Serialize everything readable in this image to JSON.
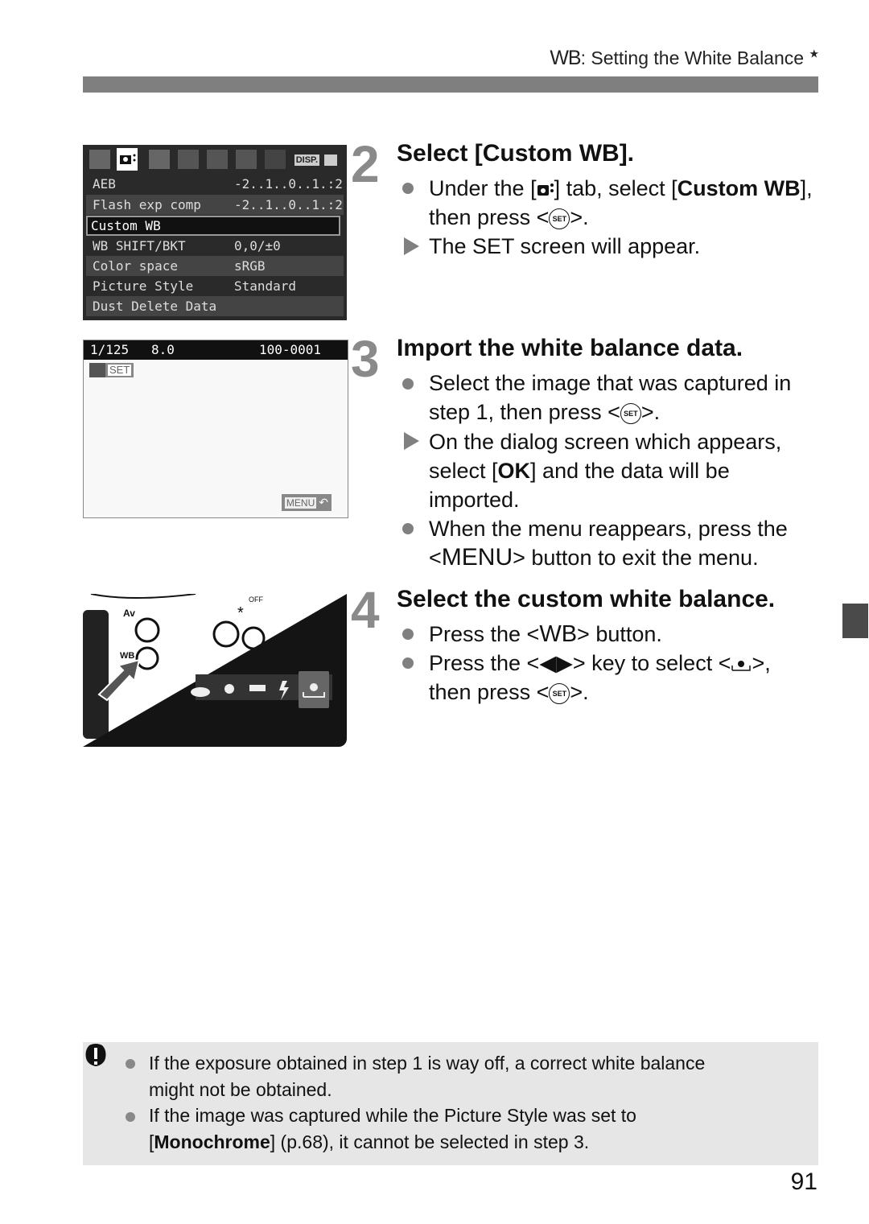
{
  "header": {
    "wb_symbol": "WB",
    "title": ": Setting the White Balance",
    "star": "★"
  },
  "lcd_menu": {
    "tabs": [
      "shooting-1",
      "shooting-2",
      "playback",
      "setup-1",
      "setup-2",
      "setup-3",
      "my-menu"
    ],
    "active_tab": 1,
    "disp_label": "DISP.",
    "rows": [
      {
        "label": "AEB",
        "value": "-2..1..0..1.:2"
      },
      {
        "label": "Flash exp comp",
        "value": "-2..1..0..1.:2"
      },
      {
        "label": "Custom WB",
        "value": ""
      },
      {
        "label": "WB SHIFT/BKT",
        "value": "0,0/±0"
      },
      {
        "label": "Color space",
        "value": "sRGB"
      },
      {
        "label": "Picture Style",
        "value": "Standard"
      },
      {
        "label": "Dust Delete Data",
        "value": ""
      }
    ],
    "selected_row": "Custom WB"
  },
  "lcd_set": {
    "shutter": "1/125",
    "aperture": "8.0",
    "file_number": "100-0001",
    "set_label": "SET",
    "menu_label": "MENU",
    "return_symbol": "↶"
  },
  "steps": [
    {
      "number": "2",
      "title": "Select [Custom WB].",
      "items": [
        {
          "type": "bullet",
          "pre": "Under the [",
          "icon": "camera-tab-icon",
          "mid": "] tab, select [",
          "bold": "Custom WB",
          "post": "], then press <",
          "set": "SET",
          "end": ">."
        },
        {
          "type": "result",
          "text": "The SET screen will appear."
        }
      ]
    },
    {
      "number": "3",
      "title": "Import the white balance data.",
      "items": [
        {
          "type": "bullet",
          "text1": "Select the image that was captured in",
          "text2": "step 1, then press <",
          "set": "SET",
          "end": ">."
        },
        {
          "type": "result",
          "text1": "On the dialog screen which appears,",
          "pre2": "select [",
          "bold": "OK",
          "post2": "] and the data will be",
          "text3": "imported."
        },
        {
          "type": "bullet",
          "text1": "When the menu reappears, press the",
          "pre2": "<",
          "menu": "MENU",
          "post2": "> button to exit the menu."
        }
      ]
    },
    {
      "number": "4",
      "title": "Select the custom white balance.",
      "items": [
        {
          "type": "bullet",
          "pre": "Press the <",
          "wb": "WB",
          "post": "> button."
        },
        {
          "type": "bullet",
          "pre": "Press the <",
          "keys": "◀▶",
          "mid": "> key to select <",
          "post": ">,",
          "text2": "then press <",
          "set": "SET",
          "end": ">."
        }
      ]
    }
  ],
  "photo": {
    "labels": [
      "Av",
      "OFF",
      "*",
      "WB"
    ]
  },
  "note": {
    "items": [
      {
        "line1": "If the exposure obtained in step 1 is way off, a correct white balance",
        "line2": "might not be obtained."
      },
      {
        "line1": "If the image was captured while the Picture Style was set to",
        "bold": "Monochrome",
        "line2_pre": "[",
        "line2_post": "] (p.68), it cannot be selected in step 3."
      }
    ]
  },
  "page_number": "91"
}
